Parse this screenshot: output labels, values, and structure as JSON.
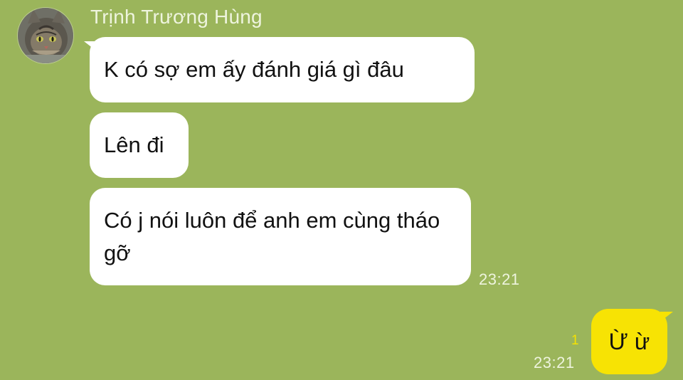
{
  "chat": {
    "sender_name": "Trịnh Trương Hùng",
    "incoming": [
      {
        "text": "K có sợ em ấy đánh giá gì đâu"
      },
      {
        "text": "Lên đi"
      },
      {
        "text": "Có j nói luôn để anh em cùng tháo gỡ"
      }
    ],
    "incoming_time": "23:21",
    "outgoing": {
      "text": "Ừ ừ",
      "time": "23:21",
      "read_count": "1"
    }
  },
  "colors": {
    "background": "#9bb55b",
    "incoming_bubble": "#ffffff",
    "outgoing_bubble": "#f7e304",
    "meta_text": "#eef4de",
    "read_count": "#f5e200"
  },
  "icons": {
    "avatar": "cat-avatar-icon"
  }
}
